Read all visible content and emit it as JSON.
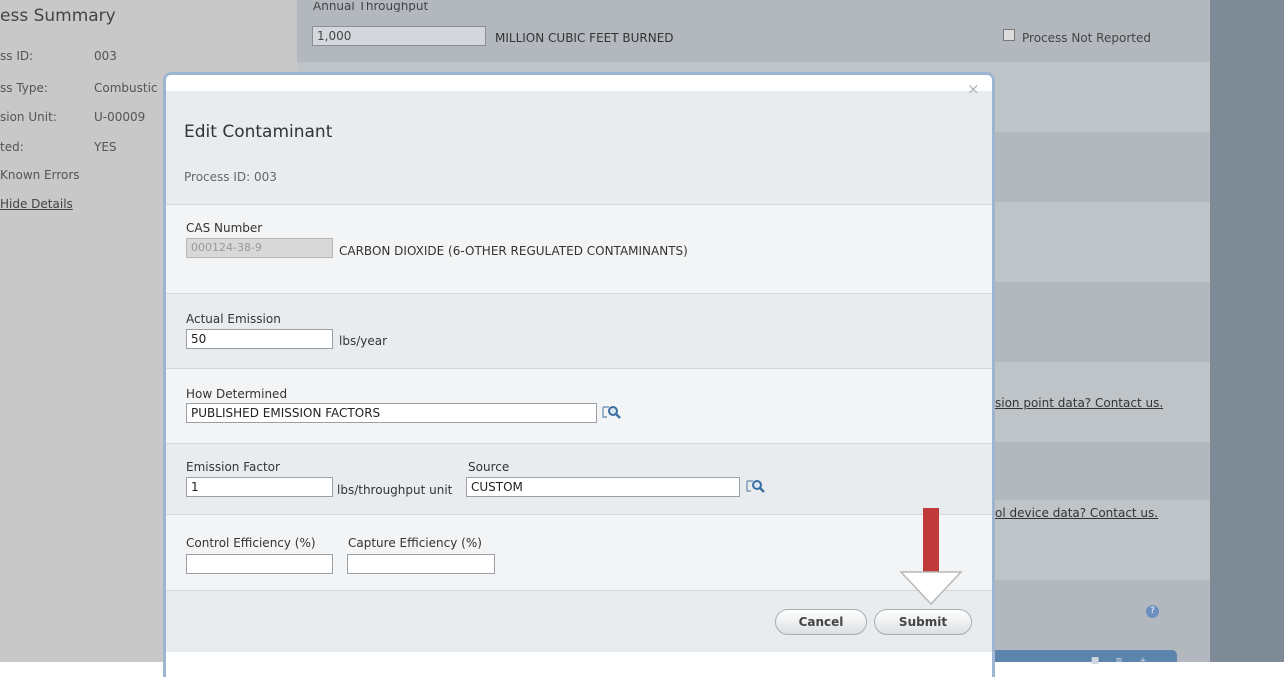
{
  "summary": {
    "title": "ess Summary",
    "rows": [
      {
        "label": "ss ID:",
        "value": "003"
      },
      {
        "label": "ss Type:",
        "value": "Combustic"
      },
      {
        "label": "sion Unit:",
        "value": "U-00009"
      },
      {
        "label": "ted:",
        "value": "YES"
      }
    ],
    "known_errors": "Known Errors",
    "hide_details": "Hide Details"
  },
  "throughput": {
    "label": "Annual Throughput",
    "value": "1,000",
    "unit": "MILLION CUBIC FEET BURNED"
  },
  "process_not_reported": "Process Not Reported",
  "contact_links": {
    "emission_point": "sion point data? Contact us.",
    "control_device": "ol device data? Contact us."
  },
  "modal": {
    "close": "×",
    "title": "Edit Contaminant",
    "process_id": "Process ID: 003",
    "cas": {
      "label": "CAS Number",
      "value": "000124-38-9",
      "description": "CARBON DIOXIDE (6-OTHER REGULATED CONTAMINANTS)"
    },
    "actual_emission": {
      "label": "Actual Emission",
      "value": "50",
      "unit": "lbs/year"
    },
    "how_determined": {
      "label": "How Determined",
      "value": "PUBLISHED EMISSION FACTORS"
    },
    "emission_factor": {
      "label": "Emission Factor",
      "value": "1",
      "unit": "lbs/throughput unit"
    },
    "source": {
      "label": "Source",
      "value": "CUSTOM"
    },
    "control_efficiency": {
      "label": "Control Efficiency (%)",
      "value": ""
    },
    "capture_efficiency": {
      "label": "Capture Efficiency (%)",
      "value": ""
    },
    "buttons": {
      "cancel": "Cancel",
      "submit": "Submit"
    }
  },
  "colors": {
    "arrow": "#c0393b",
    "modal_border": "#9db5d0",
    "toolbar": "#5b85ad"
  },
  "icons": [
    "lookup-icon",
    "close-icon",
    "help-icon",
    "down-arrow-annotation"
  ]
}
